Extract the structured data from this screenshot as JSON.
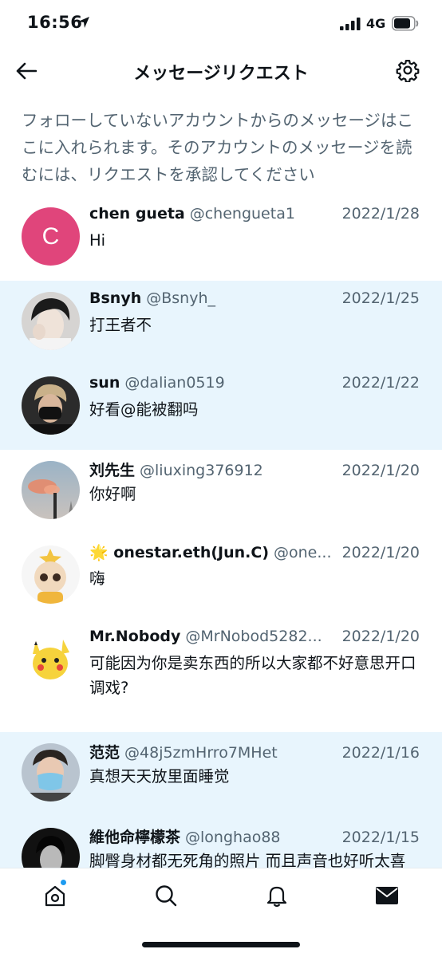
{
  "status_bar": {
    "time": "16:56",
    "network": "4G"
  },
  "nav": {
    "title": "メッセージリクエスト"
  },
  "notice": "フォローしていないアカウントからのメッセージはここに入れられます。そのアカウントのメッセージを読むには、リクエストを承認してください",
  "requests": [
    {
      "name": "chen gueta",
      "handle": "@chengueta1",
      "date": "2022/1/28",
      "message": "Hi",
      "avatar_letter": "C",
      "avatar_color": "#e0457b",
      "shaded": false
    },
    {
      "name": "Bsnyh",
      "handle": "@Bsnyh_",
      "date": "2022/1/25",
      "message": "打王者不",
      "shaded": true
    },
    {
      "name": "sun",
      "handle": "@dalian0519",
      "date": "2022/1/22",
      "message": "好看@能被翻吗",
      "shaded": true
    },
    {
      "name": "刘先生",
      "handle": "@liuxing376912",
      "date": "2022/1/20",
      "message": "你好啊",
      "shaded": false
    },
    {
      "name": "onestar.eth(Jun.C)",
      "handle": "@one...",
      "date": "2022/1/20",
      "message": "嗨",
      "name_emoji": "🌟",
      "shaded": false
    },
    {
      "name": "Mr.Nobody",
      "handle": "@MrNobod5282...",
      "date": "2022/1/20",
      "message": "可能因为你是卖东西的所以大家都不好意思开口调戏?",
      "shaded": false
    },
    {
      "name": "范范",
      "handle": "@48j5zmHrro7MHet",
      "date": "2022/1/16",
      "message": "真想天天放里面睡觉",
      "shaded": true
    },
    {
      "name": "維他命檸檬茶",
      "handle": "@longhao88",
      "date": "2022/1/15",
      "message": "脚臀身材都无死角的照片 而且声音也好听太喜欢了💕",
      "shaded": true
    }
  ],
  "colors": {
    "accent": "#1d9bf0",
    "shaded_row": "#e8f5fd",
    "secondary_text": "#536471"
  }
}
